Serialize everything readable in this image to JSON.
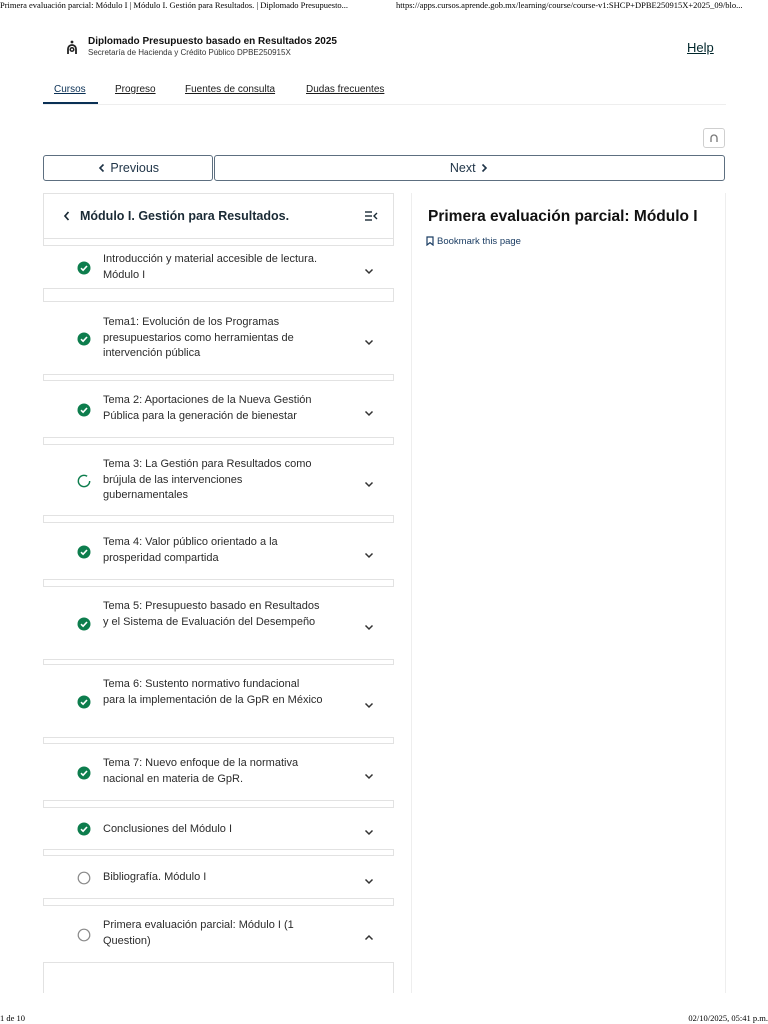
{
  "print": {
    "header_title": "Primera evaluación parcial: Módulo I | Módulo I. Gestión para Resultados. | Diplomado Presupuesto...",
    "header_url": "https://apps.cursos.aprende.gob.mx/learning/course/course-v1:SHCP+DPBE250915X+2025_09/blo...",
    "page_number": "1 de 10",
    "timestamp": "02/10/2025, 05:41 p.m."
  },
  "header": {
    "course_title": "Diplomado Presupuesto basado en Resultados 2025",
    "course_org": "Secretaría de Hacienda y Crédito Público DPBE250915X",
    "help_label": "Help"
  },
  "tabs": [
    {
      "label": "Cursos",
      "active": true
    },
    {
      "label": "Progreso",
      "active": false
    },
    {
      "label": "Fuentes de consulta",
      "active": false
    },
    {
      "label": "Dudas frecuentes",
      "active": false
    }
  ],
  "navigation": {
    "previous_label": "Previous",
    "next_label": "Next"
  },
  "sidebar": {
    "module_title": "Módulo I. Gestión para Resultados.",
    "units": [
      {
        "label": "Introducción y material accesible de lectura. Módulo I",
        "status": "complete",
        "expanded": false
      },
      {
        "label": "Tema1: Evolución de los Programas presupuestarios como herramientas de intervención pública",
        "status": "complete",
        "expanded": false
      },
      {
        "label": "Tema 2: Aportaciones de la Nueva Gestión Pública para la generación de bienestar",
        "status": "complete",
        "expanded": false
      },
      {
        "label": "Tema 3: La Gestión para Resultados como brújula de las intervenciones gubernamentales",
        "status": "in-progress",
        "expanded": false
      },
      {
        "label": "Tema 4: Valor público orientado a la prosperidad compartida",
        "status": "complete",
        "expanded": false
      },
      {
        "label": "Tema 5: Presupuesto basado en Resultados y el Sistema de Evaluación del Desempeño",
        "status": "complete",
        "expanded": false
      },
      {
        "label": "Tema 6: Sustento normativo fundacional para la implementación de la GpR en México",
        "status": "complete",
        "expanded": false
      },
      {
        "label": "Tema 7: Nuevo enfoque de la normativa nacional en materia de GpR.",
        "status": "complete",
        "expanded": false
      },
      {
        "label": "Conclusiones del Módulo I",
        "status": "complete",
        "expanded": false
      },
      {
        "label": "Bibliografía. Módulo I",
        "status": "not-started",
        "expanded": false
      },
      {
        "label": "Primera evaluación parcial: Módulo I (1 Question)",
        "status": "not-started",
        "expanded": true
      }
    ]
  },
  "content": {
    "title": "Primera evaluación parcial: Módulo I",
    "bookmark_label": "Bookmark this page"
  },
  "colors": {
    "complete": "#0d7d4d",
    "in_progress": "#0d7d4d",
    "not_started": "#8a8a8a",
    "accent": "#0a3055"
  }
}
